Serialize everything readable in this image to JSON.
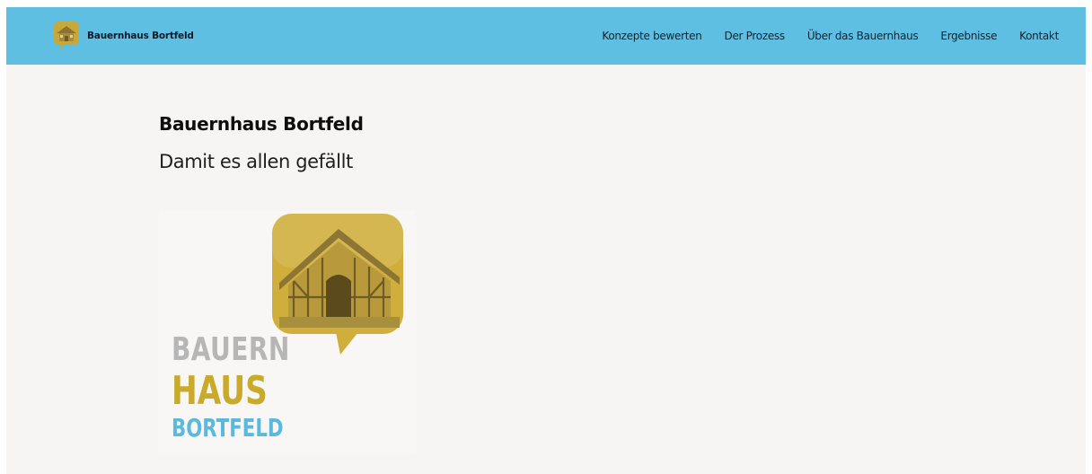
{
  "brand": {
    "name": "Bauernhaus Bortfeld",
    "icon": "house-speech-bubble-icon"
  },
  "nav": {
    "items": [
      {
        "label": "Konzepte bewerten"
      },
      {
        "label": "Der Prozess"
      },
      {
        "label": "Über das Bauernhaus"
      },
      {
        "label": "Ergebnisse"
      },
      {
        "label": "Kontakt"
      }
    ]
  },
  "hero": {
    "title": "Bauernhaus Bortfeld",
    "subtitle": "Damit es allen gefällt"
  },
  "logo": {
    "lines": [
      "BAUERN",
      "HAUS",
      "BORTFELD"
    ]
  },
  "colors": {
    "header_bg": "#5fbfe3",
    "page_bg": "#f6f5f4",
    "accent_gold": "#c9aa2b",
    "accent_blue": "#5cb9de",
    "logo_gray": "#b6b6b6"
  }
}
